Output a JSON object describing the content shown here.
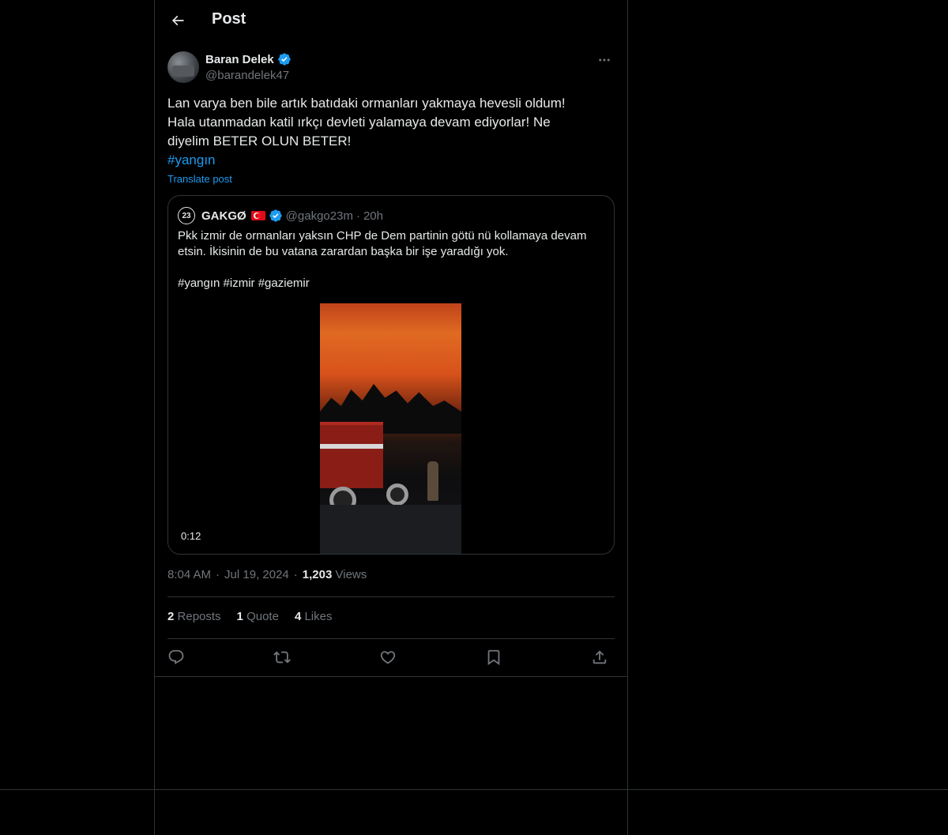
{
  "header": {
    "title": "Post"
  },
  "post": {
    "author_name": "Baran Delek",
    "author_handle": "@barandelek47",
    "text_lines": [
      "Lan varya ben bile artık batıdaki ormanları yakmaya hevesli oldum!",
      "Hala utanmadan katil ırkçı devleti yalamaya devam ediyorlar! Ne",
      "diyelim BETER OLUN BETER!"
    ],
    "hashtag": "#yangın",
    "translate_label": "Translate post",
    "time": "8:04 AM",
    "date": "Jul 19, 2024",
    "views_count": "1,203",
    "views_label": "Views",
    "separator": "·"
  },
  "quote": {
    "avatar_text": "23",
    "name": "GAKGØ",
    "handle": "@gakgo23m",
    "dot": "·",
    "age": "20h",
    "text_line1": "Pkk izmir de ormanları yaksın CHP de Dem partinin götü nü kollamaya devam etsin. İkisinin de bu vatana zarardan başka bir işe yaradığı yok.",
    "text_line2": "#yangın #izmir #gaziemir",
    "video_duration": "0:12"
  },
  "stats": {
    "reposts_count": "2",
    "reposts_label": "Reposts",
    "quotes_count": "1",
    "quotes_label": "Quote",
    "likes_count": "4",
    "likes_label": "Likes"
  },
  "icons": {
    "back": "arrow-left-icon",
    "more": "more-icon",
    "verified": "verified-badge-icon",
    "reply": "reply-icon",
    "repost": "repost-icon",
    "like": "heart-icon",
    "bookmark": "bookmark-icon",
    "share": "share-icon"
  },
  "colors": {
    "background": "#000000",
    "text": "#e7e9ea",
    "muted": "#71767b",
    "accent": "#1d9bf0",
    "border": "#2f3336"
  }
}
